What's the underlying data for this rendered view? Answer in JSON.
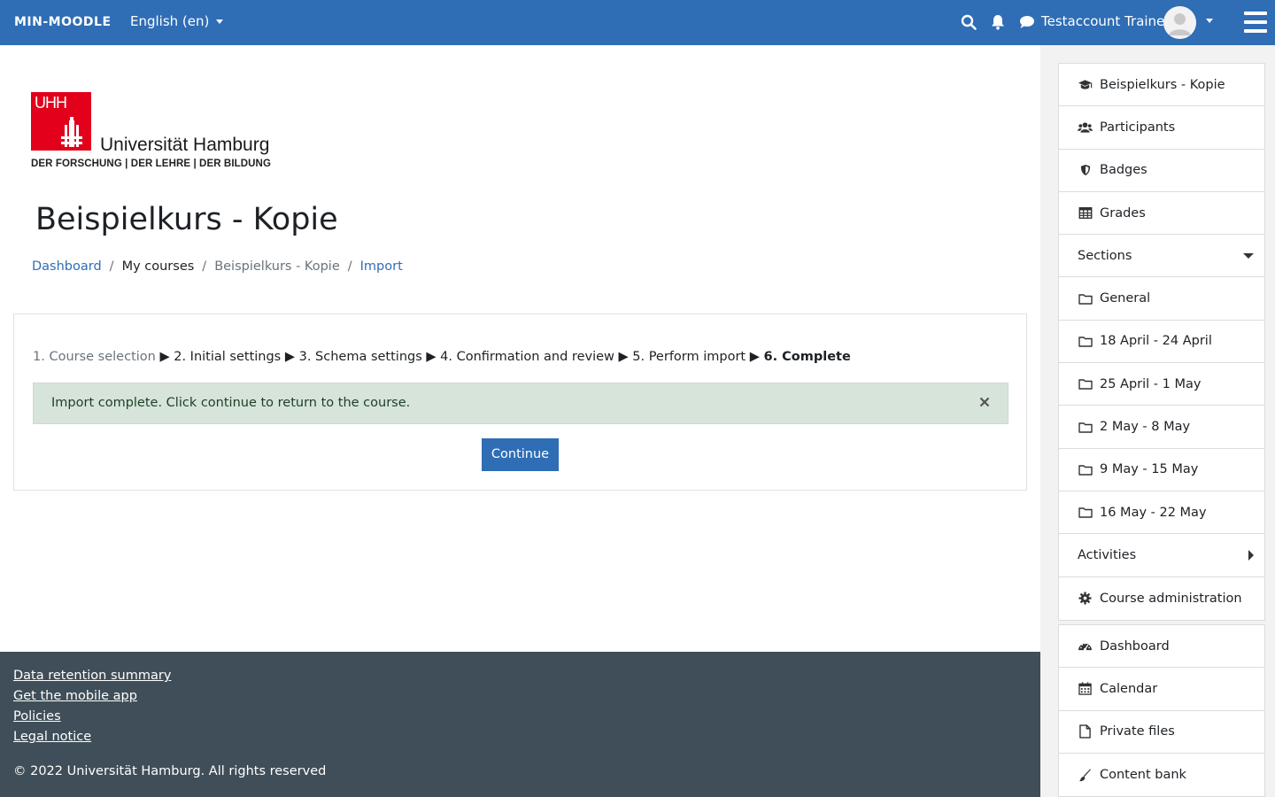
{
  "navbar": {
    "brand": "MIN-MOODLE",
    "language": "English (en)",
    "username": "Testaccount Trainer",
    "icons": [
      "search-icon",
      "bell-icon",
      "message-icon",
      "hamburger-icon"
    ]
  },
  "logo": {
    "mark": "UHH",
    "name": "Universität Hamburg",
    "tagline": "DER FORSCHUNG | DER LEHRE | DER BILDUNG"
  },
  "page": {
    "title": "Beispielkurs - Kopie",
    "breadcrumb": [
      "Dashboard",
      "My courses",
      "Beispielkurs - Kopie",
      "Import"
    ]
  },
  "import": {
    "steps": [
      "1. Course selection",
      "2. Initial settings",
      "3. Schema settings",
      "4. Confirmation and review",
      "5. Perform import",
      "6. Complete"
    ],
    "step_separator": "▶",
    "alert": "Import complete. Click continue to return to the course.",
    "continue_label": "Continue"
  },
  "footer": {
    "links": [
      "Data retention summary",
      "Get the mobile app",
      "Policies",
      "Legal notice"
    ],
    "copyright": "© 2022 Universität Hamburg. All rights reserved"
  },
  "drawer": {
    "course_nav": [
      {
        "label": "Beispielkurs - Kopie",
        "icon": "graduation-cap-icon"
      },
      {
        "label": "Participants",
        "icon": "users-icon"
      },
      {
        "label": "Badges",
        "icon": "shield-icon"
      },
      {
        "label": "Grades",
        "icon": "table-icon"
      },
      {
        "label": "Sections",
        "icon": "",
        "trail": "collapse-down"
      },
      {
        "label": "General",
        "icon": "folder-icon"
      },
      {
        "label": "18 April - 24 April",
        "icon": "folder-icon"
      },
      {
        "label": "25 April - 1 May",
        "icon": "folder-icon"
      },
      {
        "label": "2 May - 8 May",
        "icon": "folder-icon"
      },
      {
        "label": "9 May - 15 May",
        "icon": "folder-icon"
      },
      {
        "label": "16 May - 22 May",
        "icon": "folder-icon"
      },
      {
        "label": "Activities",
        "icon": "",
        "trail": "expand-right"
      },
      {
        "label": "Course administration",
        "icon": "gear-icon"
      }
    ],
    "site_nav": [
      {
        "label": "Dashboard",
        "icon": "tachometer-icon"
      },
      {
        "label": "Calendar",
        "icon": "calendar-icon"
      },
      {
        "label": "Private files",
        "icon": "file-icon"
      },
      {
        "label": "Content bank",
        "icon": "brush-icon"
      }
    ]
  },
  "colors": {
    "navbar": "#2f6db5",
    "link": "#2f6db5",
    "alert_bg": "#d7e4da",
    "footer_bg": "#3f4e58",
    "logo_red": "#e2001a"
  }
}
